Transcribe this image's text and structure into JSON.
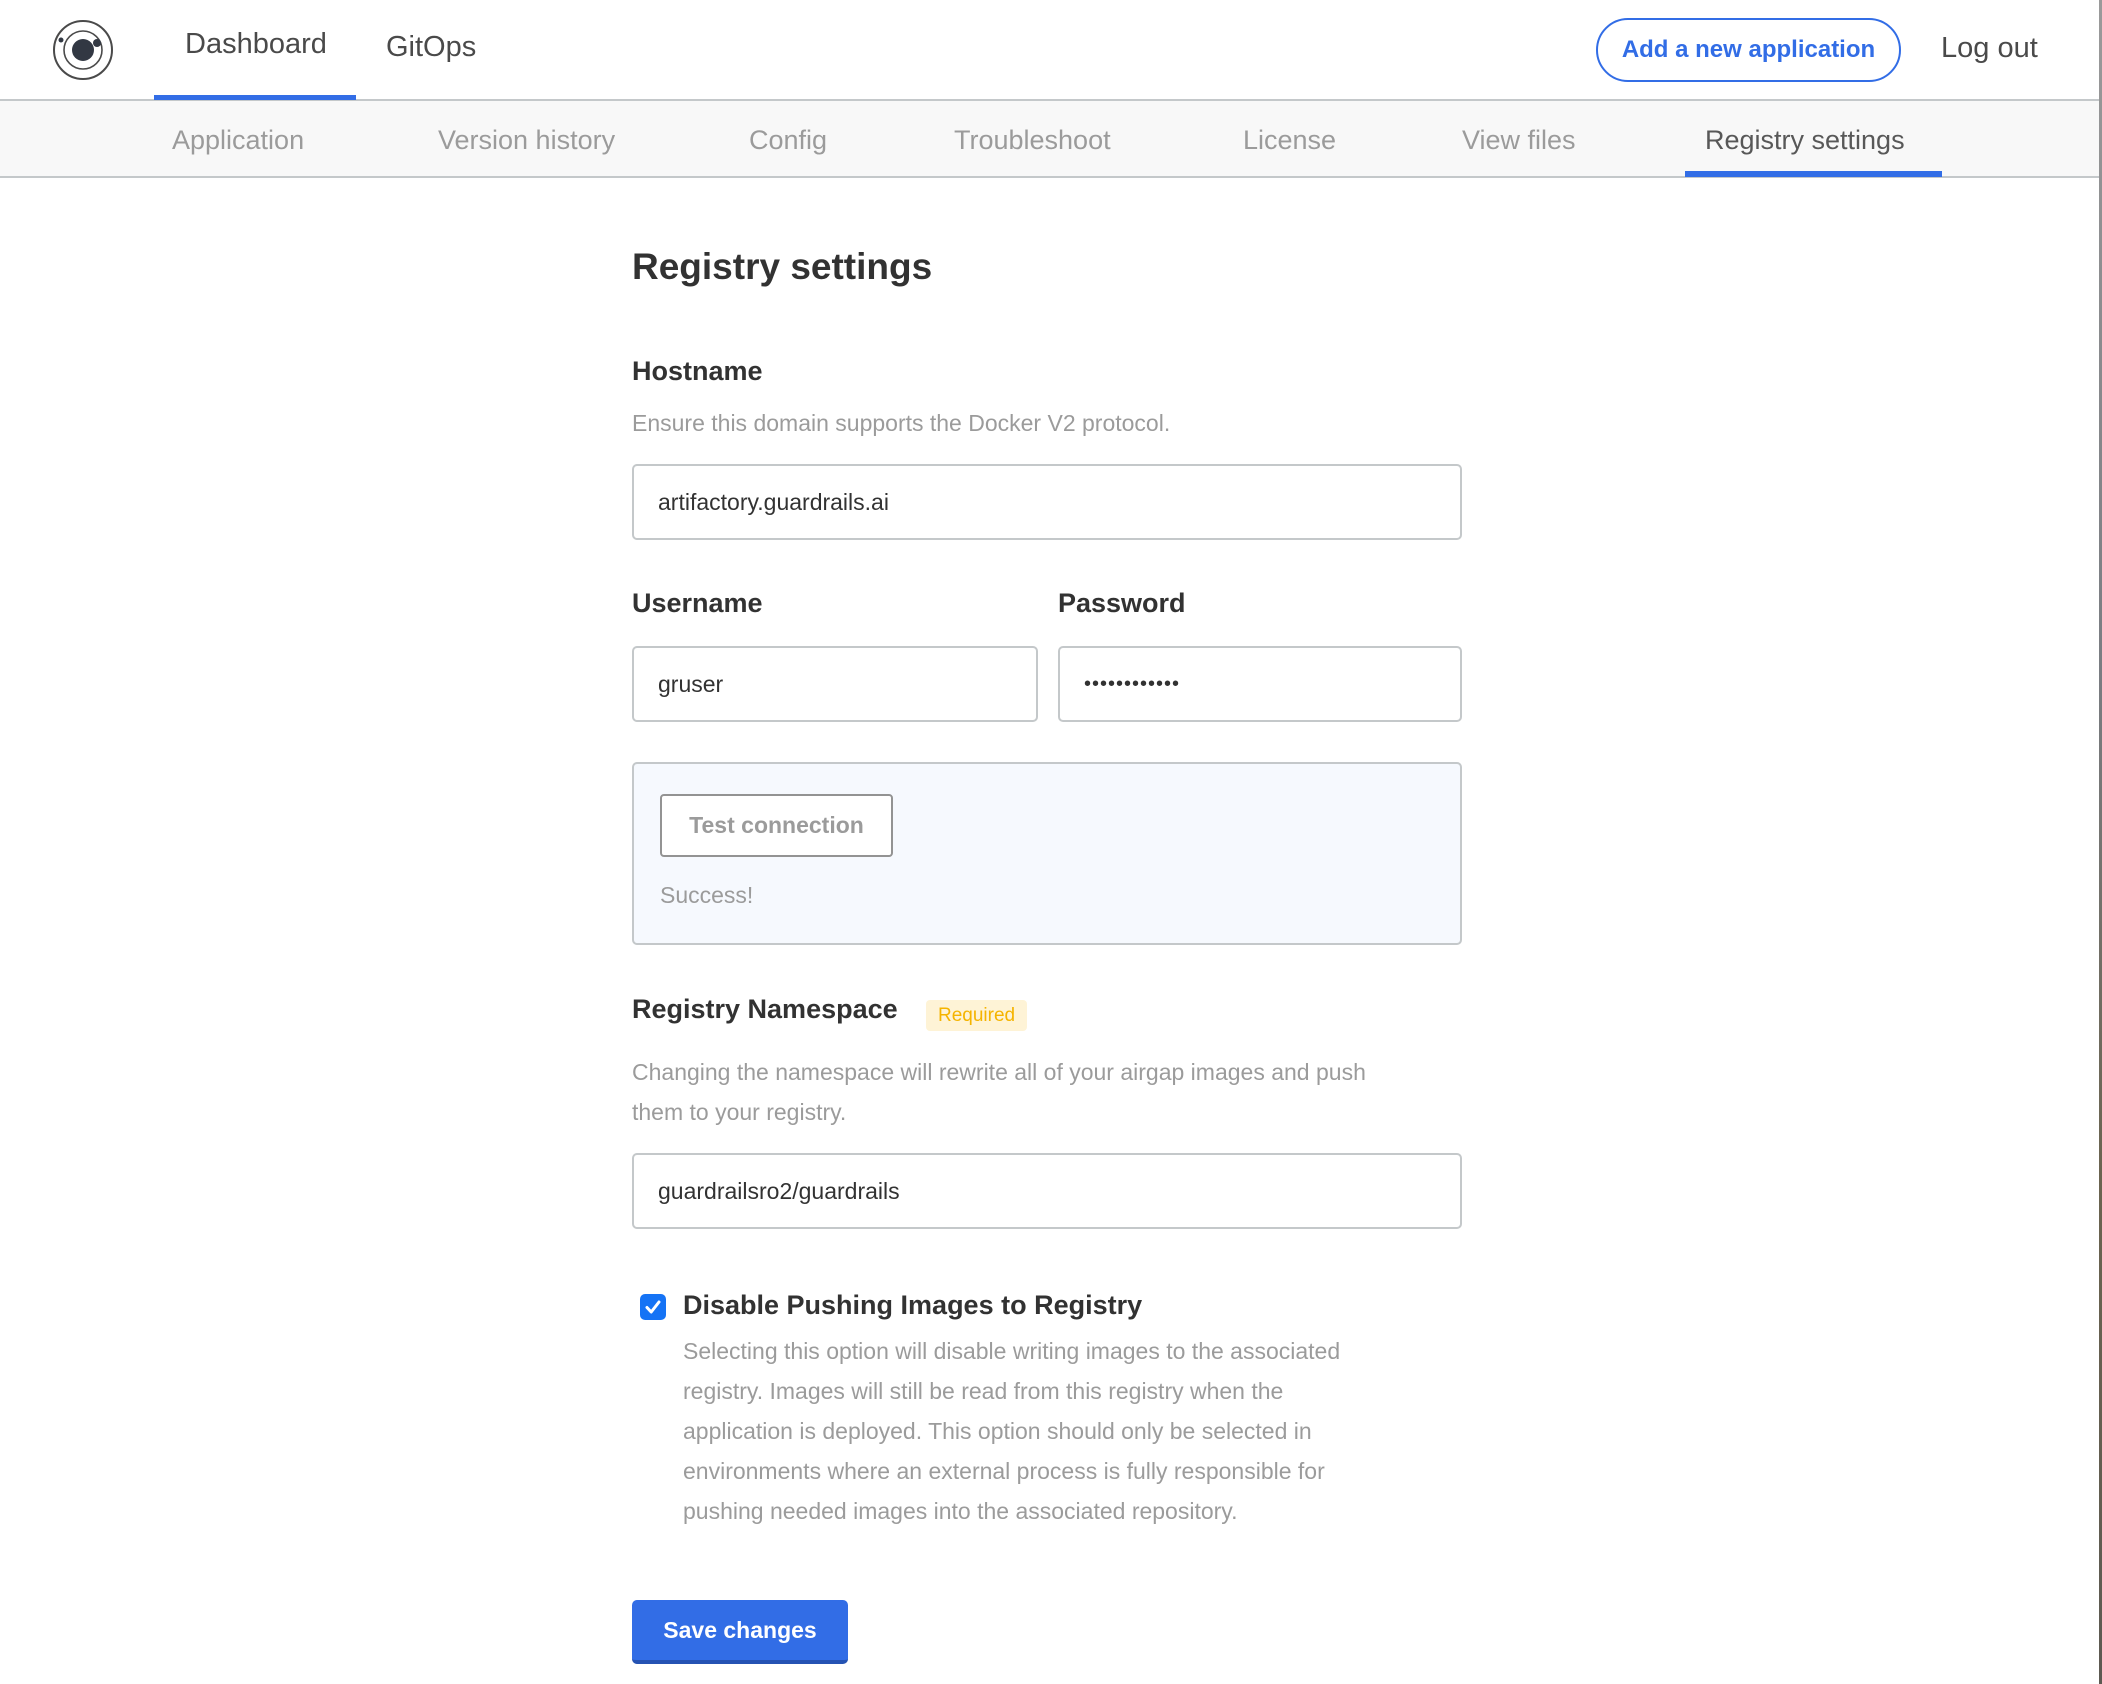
{
  "header": {
    "logo": "app-logo",
    "nav": [
      {
        "label": "Dashboard",
        "active": true
      },
      {
        "label": "GitOps",
        "active": false
      }
    ],
    "add_app_label": "Add a new application",
    "logout_label": "Log out"
  },
  "subnav": {
    "tabs": [
      {
        "label": "Application",
        "active": false
      },
      {
        "label": "Version history",
        "active": false
      },
      {
        "label": "Config",
        "active": false
      },
      {
        "label": "Troubleshoot",
        "active": false
      },
      {
        "label": "License",
        "active": false
      },
      {
        "label": "View files",
        "active": false
      },
      {
        "label": "Registry settings",
        "active": true
      }
    ]
  },
  "form": {
    "title": "Registry settings",
    "hostname": {
      "label": "Hostname",
      "description": "Ensure this domain supports the Docker V2 protocol.",
      "value": "artifactory.guardrails.ai"
    },
    "username": {
      "label": "Username",
      "value": "gruser"
    },
    "password": {
      "label": "Password",
      "value": "••••••••••••"
    },
    "test_connection": {
      "button_label": "Test connection",
      "status": "Success!"
    },
    "namespace": {
      "label": "Registry Namespace",
      "badge": "Required",
      "description_line1": "Changing the namespace will rewrite all of your airgap images and push",
      "description_line2": "them to your registry.",
      "value": "guardrailsro2/guardrails"
    },
    "disable_push": {
      "checked": true,
      "label": "Disable Pushing Images to Registry",
      "description_lines": [
        "Selecting this option will disable writing images to the associated",
        "registry. Images will still be read from this registry when the",
        "application is deployed. This option should only be selected in",
        "environments where an external process is fully responsible for",
        "pushing needed images into the associated repository."
      ]
    },
    "save_label": "Save changes"
  },
  "colors": {
    "accent": "#326de6",
    "badge_bg": "#fef3d6",
    "badge_text": "#f5b400",
    "checkbox": "#1573f5",
    "test_box_bg": "#f6f9fe"
  }
}
